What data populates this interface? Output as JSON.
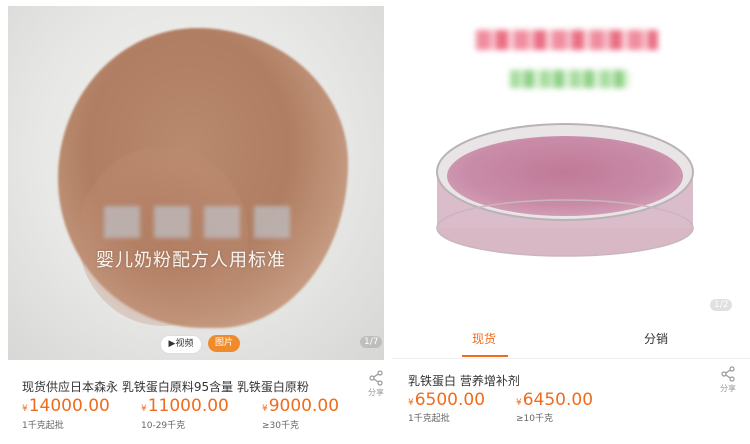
{
  "left": {
    "overlay_text": "婴儿奶粉配方人用标准",
    "media_tabs": {
      "video": "▶视频",
      "image": "图片"
    },
    "pager": "1/7",
    "product_title": "现货供应日本森永 乳铁蛋白原料95含量 乳铁蛋白原粉",
    "share_label": "分享",
    "currency": "¥",
    "prices": [
      {
        "price": "14000.00",
        "qty": "1千克起批"
      },
      {
        "price": "11000.00",
        "qty": "10-29千克"
      },
      {
        "price": "9000.00",
        "qty": "≥30千克"
      }
    ]
  },
  "right": {
    "pager": "1/2",
    "tabs": {
      "stock": "现货",
      "distribution": "分销"
    },
    "product_title": "乳铁蛋白 营养增补剂",
    "share_label": "分享",
    "currency": "¥",
    "prices": [
      {
        "price": "6500.00",
        "qty": "1千克起批"
      },
      {
        "price": "6450.00",
        "qty": "≥10千克"
      }
    ]
  },
  "colors": {
    "accent": "#f06c1d",
    "powder_left": "#b07e62",
    "powder_right": "#c98ca8"
  },
  "icons": {
    "share": "share-icon"
  }
}
